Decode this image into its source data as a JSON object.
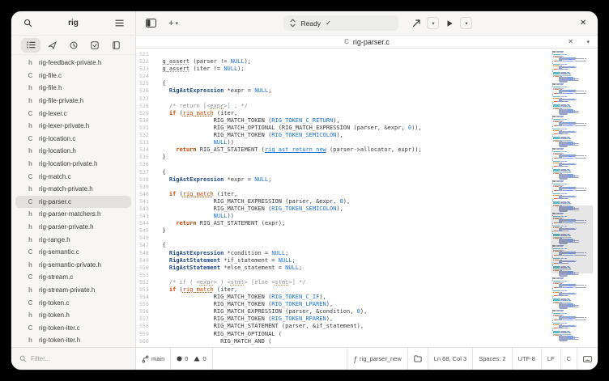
{
  "titlebar": {
    "project_title": "rig",
    "ready_label": "Ready"
  },
  "icons": {
    "plus": "+",
    "chevron_down": "▾",
    "check": "✓",
    "close": "✕",
    "function": "ƒ"
  },
  "colors": {
    "accent_blue": "#1c71d8",
    "keyword_orange": "#c64600",
    "type_navy": "#204a87",
    "comment_gray": "#898f9a"
  },
  "sidebar": {
    "filter_placeholder": "Filter...",
    "selected_file": "rig-parser.c",
    "files": [
      {
        "icon": "h",
        "name": "rig-feedback-private.h"
      },
      {
        "icon": "C",
        "name": "rig-file.c"
      },
      {
        "icon": "h",
        "name": "rig-file.h"
      },
      {
        "icon": "h",
        "name": "rig-file-private.h"
      },
      {
        "icon": "C",
        "name": "rig-lexer.c"
      },
      {
        "icon": "h",
        "name": "rig-lexer-private.h"
      },
      {
        "icon": "C",
        "name": "rig-location.c"
      },
      {
        "icon": "h",
        "name": "rig-location.h"
      },
      {
        "icon": "h",
        "name": "rig-location-private.h"
      },
      {
        "icon": "C",
        "name": "rig-match.c"
      },
      {
        "icon": "h",
        "name": "rig-match-private.h"
      },
      {
        "icon": "C",
        "name": "rig-parser.c"
      },
      {
        "icon": "h",
        "name": "rig-parser-matchers.h"
      },
      {
        "icon": "h",
        "name": "rig-parser-private.h"
      },
      {
        "icon": "h",
        "name": "rig-range.h"
      },
      {
        "icon": "C",
        "name": "rig-semantic.c"
      },
      {
        "icon": "h",
        "name": "rig-semantic-private.h"
      },
      {
        "icon": "C",
        "name": "rig-stream.c"
      },
      {
        "icon": "h",
        "name": "rig-stream-private.h"
      },
      {
        "icon": "C",
        "name": "rig-token.c"
      },
      {
        "icon": "h",
        "name": "rig-token.h"
      },
      {
        "icon": "C",
        "name": "rig-token-iter.c"
      },
      {
        "icon": "h",
        "name": "rig-token-iter.h"
      }
    ]
  },
  "tabbar": {
    "file_icon": "C",
    "title": "rig-parser.c"
  },
  "editor": {
    "lines": [
      {
        "n": 521,
        "s": []
      },
      {
        "n": 522,
        "s": [
          [
            "  ",
            "p"
          ],
          [
            "g_assert",
            "du"
          ],
          [
            " (parser != ",
            "p"
          ],
          [
            "NULL",
            "c"
          ],
          [
            ");",
            "p"
          ]
        ]
      },
      {
        "n": 523,
        "s": [
          [
            "  ",
            "p"
          ],
          [
            "g_assert",
            "du"
          ],
          [
            " (iter != ",
            "p"
          ],
          [
            "NULL",
            "c"
          ],
          [
            ");",
            "p"
          ]
        ]
      },
      {
        "n": 524,
        "s": []
      },
      {
        "n": 525,
        "s": [
          [
            "  {",
            "p"
          ]
        ]
      },
      {
        "n": 526,
        "s": [
          [
            "    ",
            "p"
          ],
          [
            "RigAstExpression",
            "t"
          ],
          [
            " *expr = ",
            "p"
          ],
          [
            "NULL",
            "c"
          ],
          [
            ";",
            "p"
          ]
        ]
      },
      {
        "n": 527,
        "s": []
      },
      {
        "n": 528,
        "s": [
          [
            "    ",
            "p"
          ],
          [
            "/* return [<",
            "cm"
          ],
          [
            "expr",
            "cu"
          ],
          [
            ">] ; */",
            "cm"
          ]
        ]
      },
      {
        "n": 529,
        "s": [
          [
            "    ",
            "p"
          ],
          [
            "if",
            "k"
          ],
          [
            " (",
            "p"
          ],
          [
            "rig_match",
            "fo"
          ],
          [
            " (iter,",
            "p"
          ]
        ]
      },
      {
        "n": 530,
        "s": [
          [
            "                 RIG_MATCH_TOKEN (",
            "p"
          ],
          [
            "RIG_TOKEN_C_RETURN",
            "c"
          ],
          [
            "),",
            "p"
          ]
        ]
      },
      {
        "n": 531,
        "s": [
          [
            "                 RIG_MATCH_OPTIONAL (RIG_MATCH_EXPRESSION (parser, &expr, ",
            "p"
          ],
          [
            "0",
            "c"
          ],
          [
            ")),",
            "p"
          ]
        ]
      },
      {
        "n": 532,
        "s": [
          [
            "                 RIG_MATCH_TOKEN (",
            "p"
          ],
          [
            "RIG_TOKEN_SEMICOLON",
            "c"
          ],
          [
            "),",
            "p"
          ]
        ]
      },
      {
        "n": 533,
        "s": [
          [
            "                 ",
            "p"
          ],
          [
            "NULL",
            "c"
          ],
          [
            "))",
            "p"
          ]
        ]
      },
      {
        "n": 534,
        "s": [
          [
            "      ",
            "p"
          ],
          [
            "return",
            "k"
          ],
          [
            " RIG_AST_STATEMENT (",
            "p"
          ],
          [
            "rig_ast_return_new",
            "lk"
          ],
          [
            " (parser->allocator, expr));",
            "p"
          ]
        ]
      },
      {
        "n": 535,
        "s": [
          [
            "  }",
            "p"
          ]
        ]
      },
      {
        "n": 536,
        "s": []
      },
      {
        "n": 537,
        "s": [
          [
            "  {",
            "p"
          ]
        ]
      },
      {
        "n": 538,
        "s": [
          [
            "    ",
            "p"
          ],
          [
            "RigAstExpression",
            "t"
          ],
          [
            " *expr = ",
            "p"
          ],
          [
            "NULL",
            "c"
          ],
          [
            ";",
            "p"
          ]
        ]
      },
      {
        "n": 539,
        "s": []
      },
      {
        "n": 540,
        "s": [
          [
            "    ",
            "p"
          ],
          [
            "if",
            "k"
          ],
          [
            " (",
            "p"
          ],
          [
            "rig_match",
            "fo"
          ],
          [
            " (iter,",
            "p"
          ]
        ]
      },
      {
        "n": 541,
        "s": [
          [
            "                 RIG_MATCH_EXPRESSION (parser, &expr, ",
            "p"
          ],
          [
            "0",
            "c"
          ],
          [
            "),",
            "p"
          ]
        ]
      },
      {
        "n": 542,
        "s": [
          [
            "                 RIG_MATCH_TOKEN (",
            "p"
          ],
          [
            "RIG_TOKEN_SEMICOLON",
            "c"
          ],
          [
            "),",
            "p"
          ]
        ]
      },
      {
        "n": 543,
        "s": [
          [
            "                 ",
            "p"
          ],
          [
            "NULL",
            "c"
          ],
          [
            "))",
            "p"
          ]
        ]
      },
      {
        "n": 544,
        "s": [
          [
            "      ",
            "p"
          ],
          [
            "return",
            "k"
          ],
          [
            " RIG_AST_STATEMENT (expr);",
            "p"
          ]
        ]
      },
      {
        "n": 545,
        "s": [
          [
            "  }",
            "p"
          ]
        ]
      },
      {
        "n": 546,
        "s": []
      },
      {
        "n": 547,
        "s": [
          [
            "  {",
            "p"
          ]
        ]
      },
      {
        "n": 548,
        "s": [
          [
            "    ",
            "p"
          ],
          [
            "RigAstExpression",
            "t"
          ],
          [
            " *condition = ",
            "p"
          ],
          [
            "NULL",
            "c"
          ],
          [
            ";",
            "p"
          ]
        ]
      },
      {
        "n": 549,
        "s": [
          [
            "    ",
            "p"
          ],
          [
            "RigAstStatement",
            "t"
          ],
          [
            " *if_statement = ",
            "p"
          ],
          [
            "NULL",
            "c"
          ],
          [
            ";",
            "p"
          ]
        ]
      },
      {
        "n": 550,
        "s": [
          [
            "    ",
            "p"
          ],
          [
            "RigAstStatement",
            "t"
          ],
          [
            " *else_statement = ",
            "p"
          ],
          [
            "NULL",
            "c"
          ],
          [
            ";",
            "p"
          ]
        ]
      },
      {
        "n": 551,
        "s": []
      },
      {
        "n": 552,
        "s": [
          [
            "    ",
            "p"
          ],
          [
            "/* if ( <",
            "cm"
          ],
          [
            "expr",
            "cu"
          ],
          [
            "> ) <",
            "cm"
          ],
          [
            "stmt",
            "cu"
          ],
          [
            "> [else <",
            "cm"
          ],
          [
            "stmt",
            "cu"
          ],
          [
            ">] */",
            "cm"
          ]
        ]
      },
      {
        "n": 553,
        "s": [
          [
            "    ",
            "p"
          ],
          [
            "if",
            "k"
          ],
          [
            " (",
            "p"
          ],
          [
            "rig_match",
            "fo"
          ],
          [
            " (iter,",
            "p"
          ]
        ]
      },
      {
        "n": 554,
        "s": [
          [
            "                 RIG_MATCH_TOKEN (",
            "p"
          ],
          [
            "RIG_TOKEN_C_IF",
            "c"
          ],
          [
            "),",
            "p"
          ]
        ]
      },
      {
        "n": 555,
        "s": [
          [
            "                 RIG_MATCH_TOKEN (",
            "p"
          ],
          [
            "RIG_TOKEN_LPAREN",
            "c"
          ],
          [
            "),",
            "p"
          ]
        ]
      },
      {
        "n": 556,
        "s": [
          [
            "                 RIG_MATCH_EXPRESSION (parser, &condition, ",
            "p"
          ],
          [
            "0",
            "c"
          ],
          [
            "),",
            "p"
          ]
        ]
      },
      {
        "n": 557,
        "s": [
          [
            "                 RIG_MATCH_TOKEN (",
            "p"
          ],
          [
            "RIG_TOKEN_RPAREN",
            "c"
          ],
          [
            "),",
            "p"
          ]
        ]
      },
      {
        "n": 558,
        "s": [
          [
            "                 RIG_MATCH_STATEMENT (parser, &if_statement),",
            "p"
          ]
        ]
      },
      {
        "n": 559,
        "s": [
          [
            "                 RIG_MATCH_OPTIONAL (",
            "p"
          ]
        ]
      },
      {
        "n": 560,
        "s": [
          [
            "                   RIG_MATCH_AND (",
            "p"
          ]
        ]
      }
    ]
  },
  "minimap": {
    "viewport_top_pct": 53,
    "viewport_height_pct": 23,
    "tile_count": 9
  },
  "statusbar": {
    "branch": "main",
    "error_count": "0",
    "warning_count": "0",
    "symbol": "rig_parser_new",
    "position": "Ln 68, Col 3",
    "spaces": "Spaces: 2",
    "encoding": "UTF-8",
    "line_ending": "LF",
    "language": "C"
  }
}
